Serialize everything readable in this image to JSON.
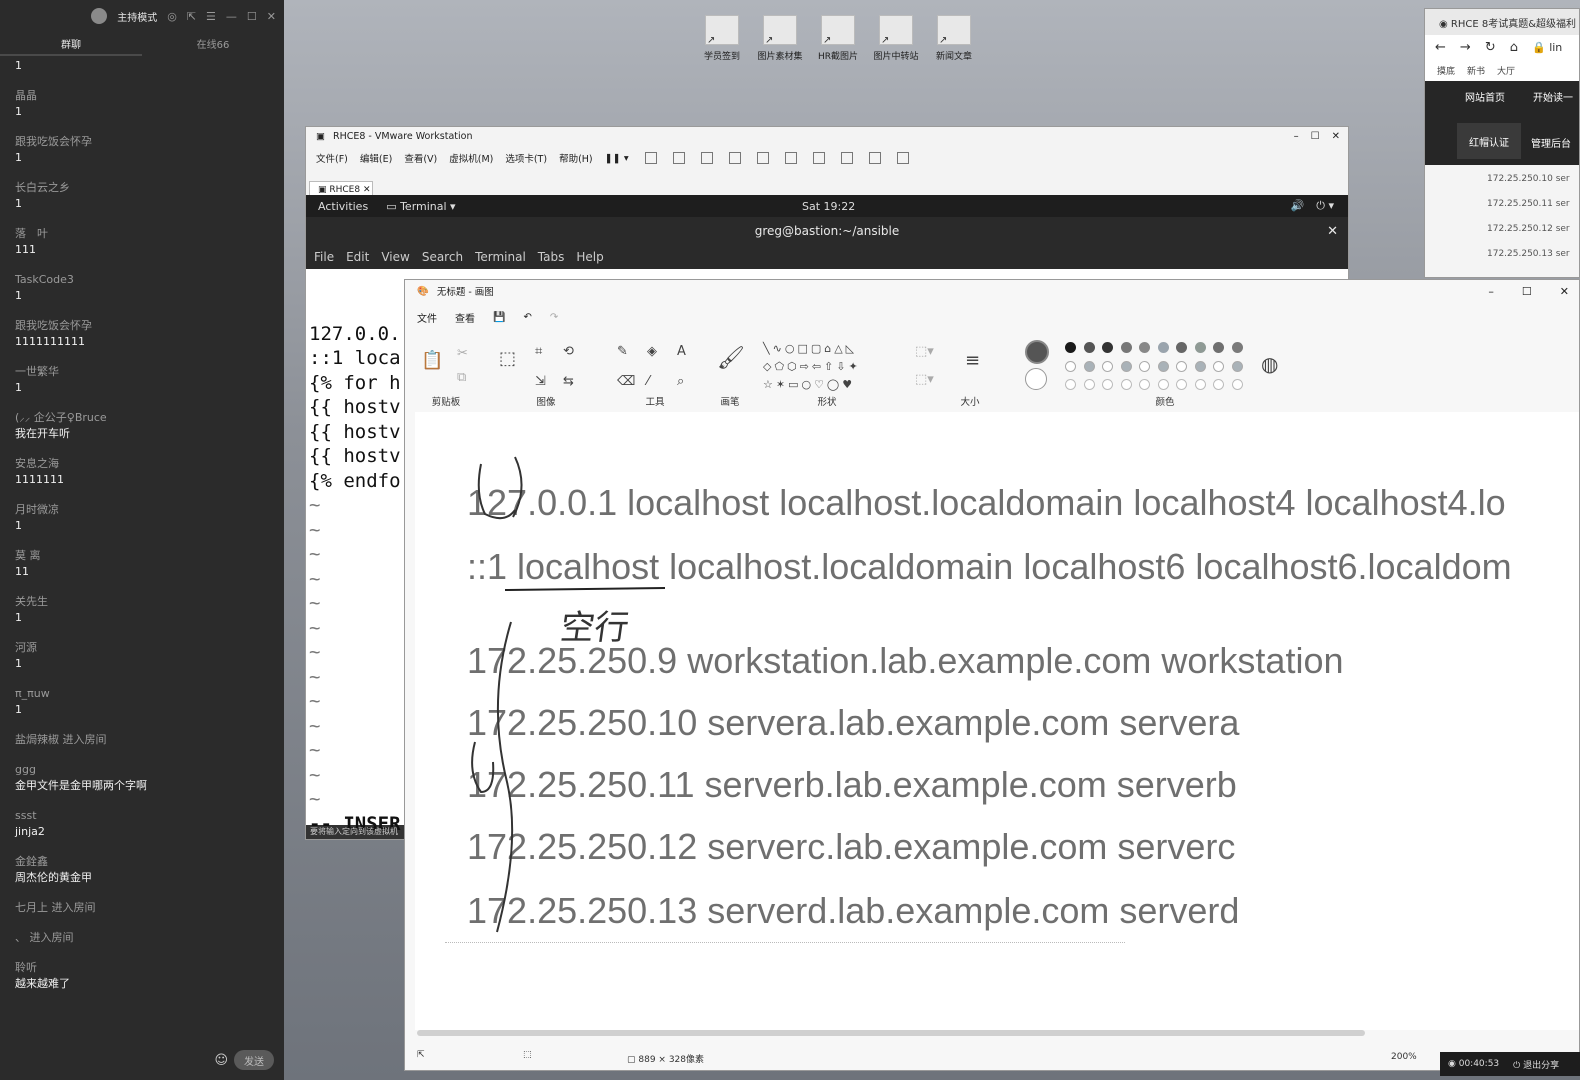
{
  "chat": {
    "host_mode": "主持模式",
    "tabs": [
      "群聊",
      "在线66"
    ],
    "messages": [
      {
        "user": "",
        "text": "1"
      },
      {
        "user": "晶晶",
        "text": "1"
      },
      {
        "user": "跟我吃饭会怀孕",
        "text": "1"
      },
      {
        "user": "长白云之乡",
        "text": "1"
      },
      {
        "user": "落　叶",
        "text": "111"
      },
      {
        "user": "TaskCode3",
        "text": "1"
      },
      {
        "user": "跟我吃饭会怀孕",
        "text": "1111111111"
      },
      {
        "user": "一世繁华",
        "text": "1"
      },
      {
        "user": "(⸝⸝ 企公子♀Bruce",
        "text": "我在开车听"
      },
      {
        "user": "安息之海",
        "text": "1111111"
      },
      {
        "user": "月时微凉",
        "text": "1"
      },
      {
        "user": "莫 离",
        "text": "11"
      },
      {
        "user": "关先生",
        "text": "1"
      },
      {
        "user": "河源",
        "text": "1"
      },
      {
        "user": "π_πuw",
        "text": "1"
      },
      {
        "user": "盐焗辣椒 进入房间",
        "text": ""
      },
      {
        "user": "ggg",
        "text": "金甲文件是金甲哪两个字啊"
      },
      {
        "user": "ssst",
        "text": "jinja2"
      },
      {
        "user": "金銓鑫",
        "text": "周杰伦的黄金甲"
      },
      {
        "user": "七月上 进入房间",
        "text": ""
      },
      {
        "user": "、 进入房间",
        "text": ""
      },
      {
        "user": "聆听",
        "text": "越来越难了"
      }
    ],
    "send_label": "发送"
  },
  "desktop": {
    "icons": [
      "学员签到",
      "图片素材集",
      "HR截图片",
      "图片中转站",
      "新闻文章"
    ]
  },
  "browser": {
    "tab_title": "RHCE 8考试真题&超级福利",
    "url_fragment": "lin",
    "bookmarks": [
      "摸底",
      "新书",
      "大厅"
    ],
    "nav": {
      "home": "网站首页",
      "start": "开始读一",
      "cert": "红帽认证",
      "admin": "管理后台"
    },
    "host_lines": [
      "172.25.250.10 ser",
      "172.25.250.11 ser",
      "172.25.250.12 ser",
      "172.25.250.13 ser"
    ]
  },
  "vmware": {
    "title": "RHCE8 - VMware Workstation",
    "menu": [
      "文件(F)",
      "编辑(E)",
      "查看(V)",
      "虚拟机(M)",
      "选项卡(T)",
      "帮助(H)"
    ],
    "tab": "RHCE8",
    "gnome": {
      "activities": "Activities",
      "terminal": "Terminal ▾",
      "clock": "Sat 19:22"
    },
    "terminal_title": "greg@bastion:~/ansible",
    "terminal_menu": [
      "File",
      "Edit",
      "View",
      "Search",
      "Terminal",
      "Tabs",
      "Help"
    ],
    "terminal_lines": [
      "127.0.0.",
      "::1 loca",
      "{% for h",
      "{{ hostv",
      "{{ hostv",
      "{{ hostv",
      "{% endfo"
    ],
    "insert_line": "-- INSER",
    "status": "要将输入定向到该虚拟机"
  },
  "paint": {
    "title": "无标题 - 画图",
    "menu": [
      "文件",
      "查看"
    ],
    "groups": [
      "剪贴板",
      "图像",
      "工具",
      "画笔",
      "形状",
      "大小",
      "颜色"
    ],
    "canvas_lines": [
      "127.0.0.1 localhost localhost.localdomain localhost4 localhost4.lo",
      "::1 localhost localhost.localdomain localhost6 localhost6.localdom",
      "172.25.250.9     workstation.lab.example.com       workstation",
      "172.25.250.10   servera.lab.example.com servera",
      "172.25.250.11   serverb.lab.example.com serverb",
      "172.25.250.12   serverc.lab.example.com serverc",
      "172.25.250.13   serverd.lab.example.com serverd"
    ],
    "handwriting": "空行",
    "dimensions": "889 × 328像素",
    "zoom": "200%",
    "swatch_colors": [
      "#1a1a1a",
      "#555555",
      "#333333",
      "#777777",
      "#888888",
      "#9aa4ad",
      "#666666",
      "#8f9a95",
      "#6f6f6f",
      "#7a7a7a"
    ]
  },
  "overlay": {
    "timer": "00:40:53",
    "exit_share": "退出分享"
  }
}
